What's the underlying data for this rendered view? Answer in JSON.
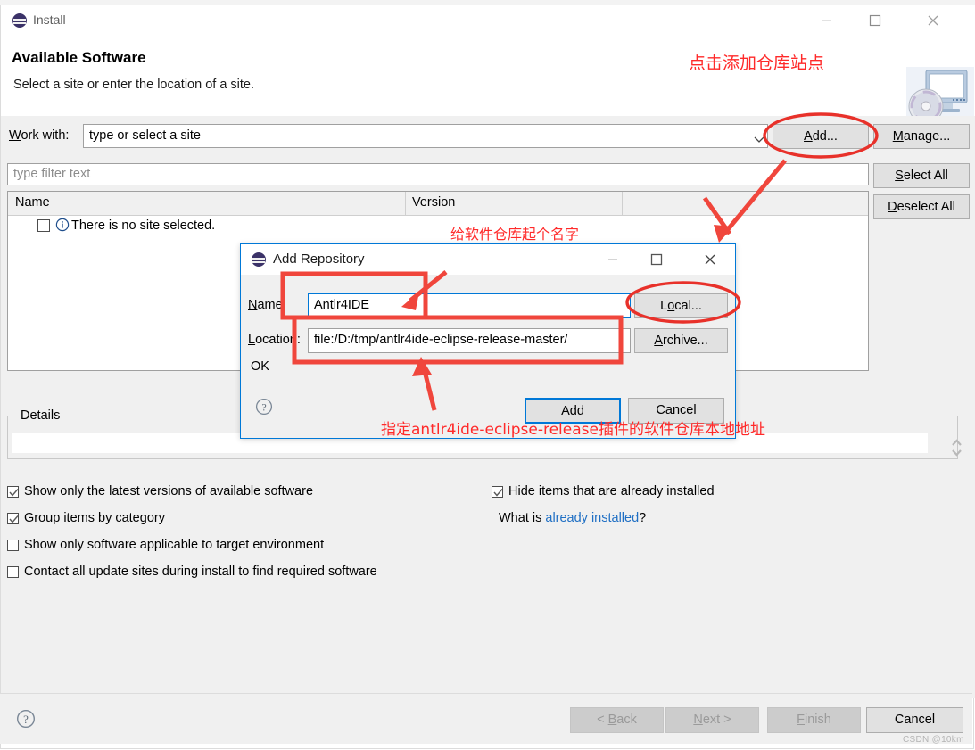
{
  "background_window": {
    "sliver_text": ".... ... ..... ........ ..... ......... ...... ..... ...... ... . ......... ....."
  },
  "window": {
    "title": "Install",
    "icon": "eclipse-icon",
    "minimize_icon": "minimize-icon",
    "maximize_icon": "maximize-icon",
    "close_icon": "close-icon",
    "page_title": "Available Software",
    "page_subtitle": "Select a site or enter the location of a site.",
    "header_icon": "install-monitor-cd-icon"
  },
  "work_with": {
    "label": "Work with:",
    "value": "type or select a site",
    "placeholder": "type or select a site",
    "dropdown_icon": "chevron-down-icon"
  },
  "buttons": {
    "add": "Add...",
    "manage": "Manage...",
    "select_all": "Select All",
    "deselect_all": "Deselect All"
  },
  "filter": {
    "placeholder": "type filter text",
    "value": ""
  },
  "table": {
    "columns": [
      "Name",
      "Version"
    ],
    "rows": [
      {
        "checked": false,
        "icon": "info-icon",
        "name": "There is no site selected.",
        "version": ""
      }
    ]
  },
  "details": {
    "legend": "Details",
    "value": "",
    "spinner_icon": "spinner-up-down-icon"
  },
  "options": {
    "left": [
      {
        "label": "Show only the latest versions of available software",
        "checked": true,
        "mnemonic": "l"
      },
      {
        "label": "Group items by category",
        "checked": true,
        "mnemonic": "G"
      },
      {
        "label": "Show only software applicable to target environment",
        "checked": false,
        "mnemonic": ""
      },
      {
        "label": "Contact all update sites during install to find required software",
        "checked": false,
        "mnemonic": "C"
      }
    ],
    "right": [
      {
        "label": "Hide items that are already installed",
        "checked": true,
        "mnemonic": "H"
      }
    ],
    "what_is_prefix": "What is ",
    "what_is_link": "already installed",
    "what_is_suffix": "?"
  },
  "wizard_buttons": {
    "back": "< Back",
    "next": "Next >",
    "finish": "Finish",
    "cancel": "Cancel",
    "help_icon": "help-question-icon"
  },
  "watermark": "CSDN @10km",
  "dialog": {
    "title": "Add Repository",
    "icon": "eclipse-icon",
    "minimize_icon": "minimize-icon",
    "maximize_icon": "maximize-icon",
    "close_icon": "close-icon",
    "name_label": "Name:",
    "name_value": "Antlr4IDE",
    "local_button": "Local...",
    "location_label": "Location:",
    "location_value": "file:/D:/tmp/antlr4ide-eclipse-release-master/",
    "archive_button": "Archive...",
    "status_text": "OK",
    "help_icon": "help-question-icon",
    "add_button": "Add",
    "cancel_button": "Cancel"
  },
  "annotations": {
    "top": "点击添加仓库站点",
    "middle": "给软件仓库起个名字",
    "bottom": "指定antlr4ide-eclipse-release插件的软件仓库本地地址",
    "color": "#ff2a2a"
  }
}
